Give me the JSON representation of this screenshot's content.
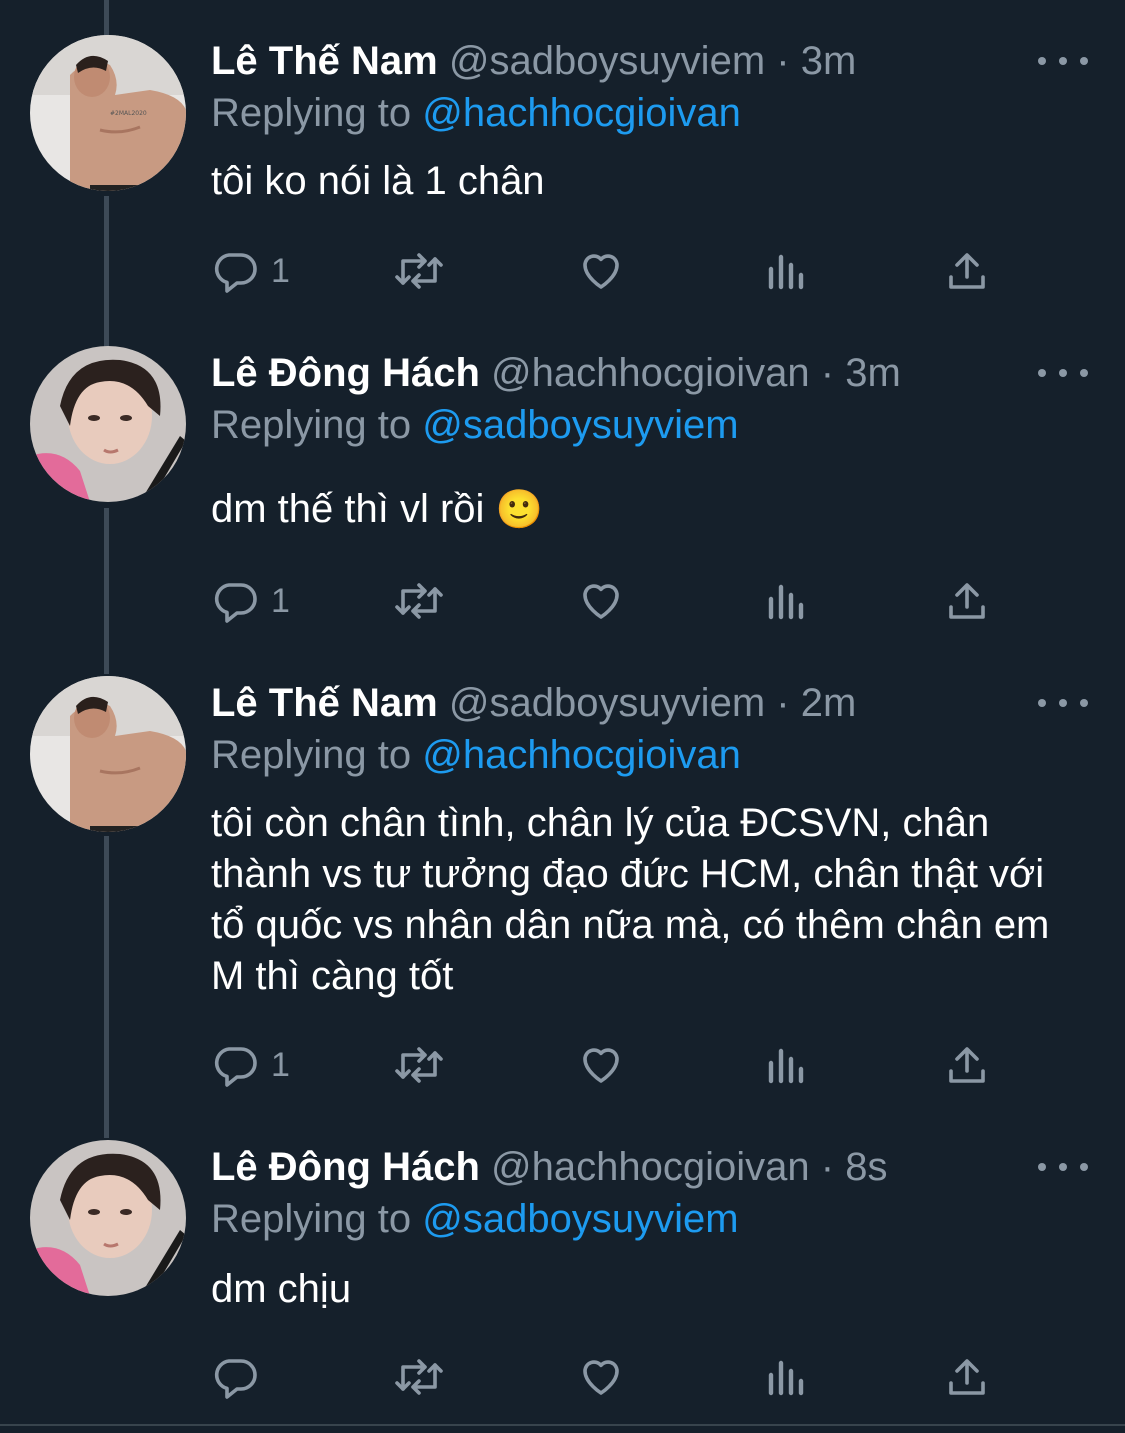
{
  "tweets": [
    {
      "name": "Lê Thế Nam",
      "handle": "@sadboysuyviem",
      "dot": "·",
      "time": "3m",
      "replying_prefix": "Replying to",
      "replying_to": "@hachhocgioivan",
      "text": "tôi ko nói là 1 chân",
      "emoji": "",
      "reply_count": "1"
    },
    {
      "name": "Lê Đông Hách",
      "handle": "@hachhocgioivan",
      "dot": "·",
      "time": "3m",
      "replying_prefix": "Replying to",
      "replying_to": "@sadboysuyviem",
      "text": "dm thế thì vl rồi",
      "emoji": "🙂",
      "reply_count": "1"
    },
    {
      "name": "Lê Thế Nam",
      "handle": "@sadboysuyviem",
      "dot": "·",
      "time": "2m",
      "replying_prefix": "Replying to",
      "replying_to": "@hachhocgioivan",
      "text": "tôi còn chân tình, chân lý của ĐCSVN, chân thành vs tư tưởng đạo đức HCM, chân thật với tổ quốc vs nhân dân nữa mà, có thêm chân em M thì càng tốt",
      "emoji": "",
      "reply_count": "1"
    },
    {
      "name": "Lê Đông Hách",
      "handle": "@hachhocgioivan",
      "dot": "·",
      "time": "8s",
      "replying_prefix": "Replying to",
      "replying_to": "@sadboysuyviem",
      "text": "dm chịu",
      "emoji": "",
      "reply_count": ""
    }
  ],
  "icons": {
    "reply": "reply-icon",
    "retweet": "retweet-icon",
    "like": "heart-icon",
    "analytics": "analytics-icon",
    "share": "share-icon",
    "more": "more-icon"
  },
  "colors": {
    "background": "#15202b",
    "secondary_text": "#8b98a5",
    "mention": "#1d9bf0",
    "thread_line": "#3d4a57"
  }
}
